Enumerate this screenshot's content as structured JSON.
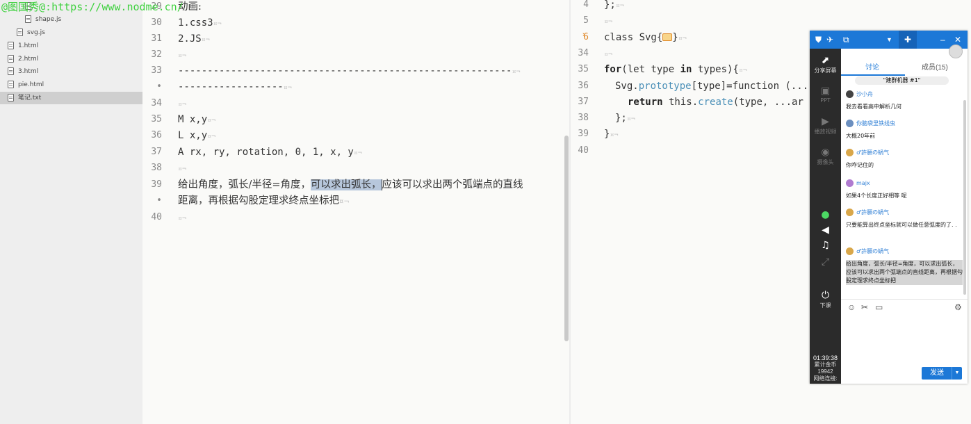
{
  "watermark": "@图国秀@:https://www.nodme.cn/",
  "file_tree": {
    "items": [
      {
        "name": "shape.js"
      },
      {
        "name": "svg.js"
      },
      {
        "name": "1.html"
      },
      {
        "name": "2.html"
      },
      {
        "name": "3.html"
      },
      {
        "name": "pie.html"
      },
      {
        "name": "笔记.txt",
        "active": true
      }
    ],
    "top_partial": "..."
  },
  "left_editor": {
    "lines": [
      {
        "n": "29",
        "text": "动画:"
      },
      {
        "n": "30",
        "text": "1.css3"
      },
      {
        "n": "31",
        "text": "2.JS"
      },
      {
        "n": "32",
        "text": ""
      },
      {
        "n": "33",
        "text": "---------------------------------------------------------"
      },
      {
        "n": "•",
        "text": "------------------"
      },
      {
        "n": "34",
        "text": ""
      },
      {
        "n": "35",
        "text": "M x,y"
      },
      {
        "n": "36",
        "text": "L x,y"
      },
      {
        "n": "37",
        "text": "A rx, ry, rotation, 0, 1, x, y"
      },
      {
        "n": "38",
        "text": ""
      },
      {
        "n": "39",
        "pre": "给出角度，弧长/半径=角度，",
        "sel": "可以求出弧长，",
        "post": "应该可以求出两个弧端点的直线"
      },
      {
        "n": "•",
        "text": "距离，再根据勾股定理求终点坐标把"
      },
      {
        "n": "40",
        "text": ""
      }
    ],
    "ws_mark": "¤¬"
  },
  "right_editor": {
    "lines": [
      {
        "n": "4",
        "text": "};"
      },
      {
        "n": "5",
        "text": ""
      },
      {
        "n": "6",
        "pre": "class Svg{",
        "post": "}"
      },
      {
        "n": "34",
        "text": ""
      },
      {
        "n": "35",
        "kw": "for",
        "t1": "(let type ",
        "kw2": "in",
        "t2": " types){"
      },
      {
        "n": "36",
        "t1": "Svg.",
        "fn": "prototype",
        "t2": "[type]=function (..."
      },
      {
        "n": "37",
        "kw": "return",
        "t1": " this.",
        "fn": "create",
        "t2": "(type, ...ar"
      },
      {
        "n": "38",
        "text": "};"
      },
      {
        "n": "39",
        "text": "}"
      },
      {
        "n": "40",
        "text": ""
      }
    ]
  },
  "chat": {
    "tabs": [
      "讨论",
      "成员(15)"
    ],
    "pinned": "\"建群机器 #1\"",
    "sidebar": [
      {
        "label": "分享屏幕",
        "icon": "share-screen-icon"
      },
      {
        "label": "PPT",
        "icon": "ppt-icon"
      },
      {
        "label": "播放视频",
        "icon": "video-icon"
      },
      {
        "label": "摄像头",
        "icon": "camera-icon"
      },
      {
        "label": "下课",
        "icon": "end-class-icon"
      }
    ],
    "messages": [
      {
        "user": "沙小舟",
        "text": "我去看看高中解析几何"
      },
      {
        "user": "你脑袋里铁线虫",
        "text": "大概20年前"
      },
      {
        "user": "♂許願の蝸气",
        "text": "你咋记住的"
      },
      {
        "user": "majx",
        "text": "如果4个长度正好相等 呢"
      },
      {
        "user": "♂許願の蝸气",
        "text": "只要能算出终点坐标就可以做任意弧度的了. ."
      },
      {
        "user": "♂許願の蝸气",
        "text": "给出角度，弧长/半径=角度，可以求出弧长，应该可以求出两个弧端点的直线距离，再根据勾股定理求终点坐标把"
      }
    ],
    "time": "01:39:38",
    "stats": [
      "累计金币",
      "19942",
      "网络连接:"
    ],
    "send_label": "发送",
    "accent": "#1c78d7"
  }
}
